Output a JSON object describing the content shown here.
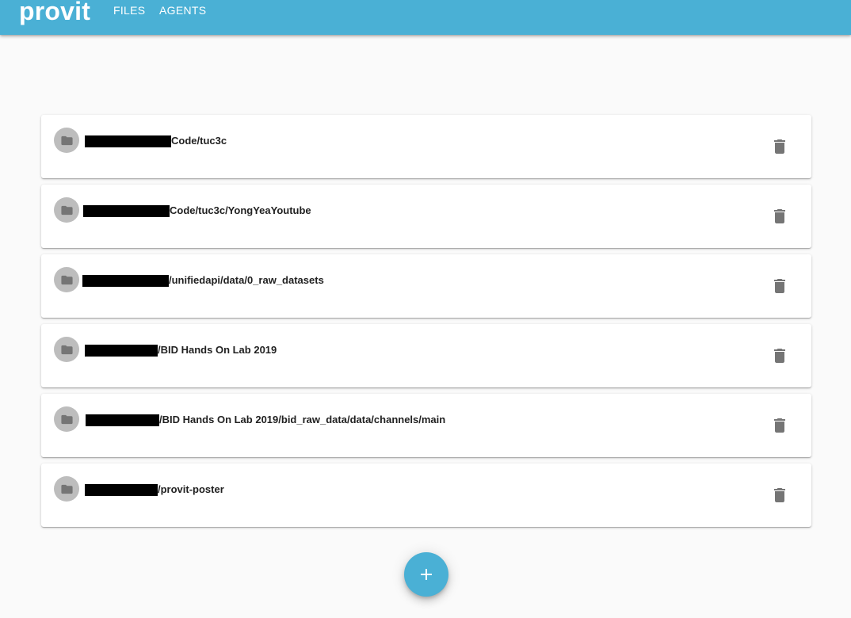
{
  "app": {
    "brand": "provit",
    "nav": [
      "FILES",
      "AGENTS"
    ]
  },
  "colors": {
    "primary": "#4ab0d5",
    "background": "#fafafa",
    "avatar": "#bdbdbd",
    "icon": "#757575"
  },
  "directories": [
    {
      "suffix": "Code/tuc3c",
      "redacted": true
    },
    {
      "suffix": "Code/tuc3c/YongYeaYoutube",
      "redacted": true
    },
    {
      "suffix": "/unifiedapi/data/0_raw_datasets",
      "redacted": true
    },
    {
      "suffix": "/BID Hands On Lab 2019",
      "redacted": true
    },
    {
      "suffix": "/BID Hands On Lab 2019/bid_raw_data/data/channels/main",
      "redacted": true
    },
    {
      "suffix": "/provit-poster",
      "redacted": true
    }
  ],
  "icons": {
    "row_icon": "folder-icon",
    "row_action": "delete-icon",
    "fab": "add-icon"
  }
}
